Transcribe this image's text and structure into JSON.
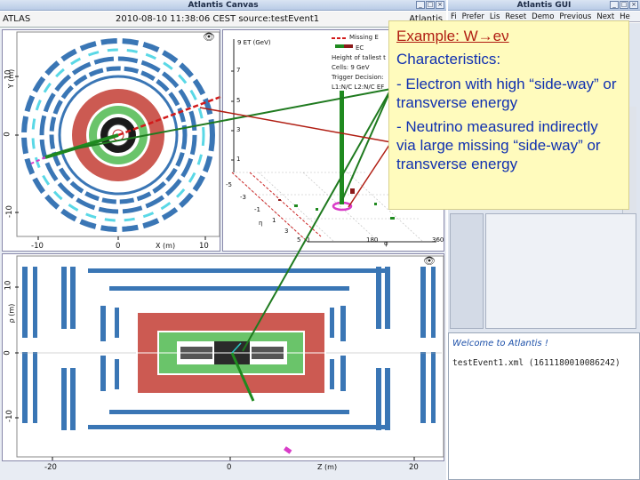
{
  "canvas_window": {
    "title": "Atlantis Canvas",
    "btn_min": "_",
    "btn_max": "□",
    "btn_close": "×"
  },
  "gui_window": {
    "title": "Atlantis GUI",
    "btn_min": "_",
    "btn_max": "□",
    "btn_close": "×"
  },
  "infobar": {
    "left": "ATLAS",
    "center": "2010-08-10 11:38:06 CEST source:testEvent1",
    "right": "Atlantis"
  },
  "gui_menu": [
    "Fi",
    "Prefer",
    "Lis",
    "Reset",
    "Demo",
    "Previous",
    "Next",
    "He"
  ],
  "gui_log": {
    "welcome": "Welcome to Atlantis !",
    "event": "testEvent1.xml (1611180010086242)"
  },
  "yx_view": {
    "ylabel": "Y (m)",
    "xlabel": "X (m)",
    "y_ticks": [
      "10",
      "0",
      "-10"
    ],
    "x_ticks": [
      "-10",
      "0",
      "10"
    ]
  },
  "lego_view": {
    "z_label": "9 ET (GeV)",
    "z_ticks": [
      "7",
      "5",
      "3",
      "1"
    ],
    "eta_label": "η",
    "eta_ticks": [
      "-5",
      "-3",
      "-1",
      "1",
      "3",
      "5"
    ],
    "phi_label": "φ",
    "phi_ticks": [
      "0",
      "180",
      "360"
    ],
    "legend": [
      "Missing E",
      "EC",
      "Height of tallest t",
      "Cells: 9 GeV",
      "Trigger Decision:",
      "L1:N/C L2:N/C EF"
    ]
  },
  "rz_view": {
    "ylabel": "ρ (m)",
    "xlabel": "Z (m)",
    "y_ticks": [
      "10",
      "0",
      "-10"
    ],
    "x_ticks": [
      "-20",
      "0",
      "20"
    ]
  },
  "annotation": {
    "title": "Example: W→eν",
    "subtitle": "Characteristics:",
    "bullet1": "- Electron with high “side-way” or transverse energy",
    "bullet2": "- Neutrino measured indirectly via large missing “side-way” or transverse energy"
  },
  "colors": {
    "accent": "#1030b0",
    "title_red": "#b01d12",
    "note_bg": "#fffbbd"
  }
}
